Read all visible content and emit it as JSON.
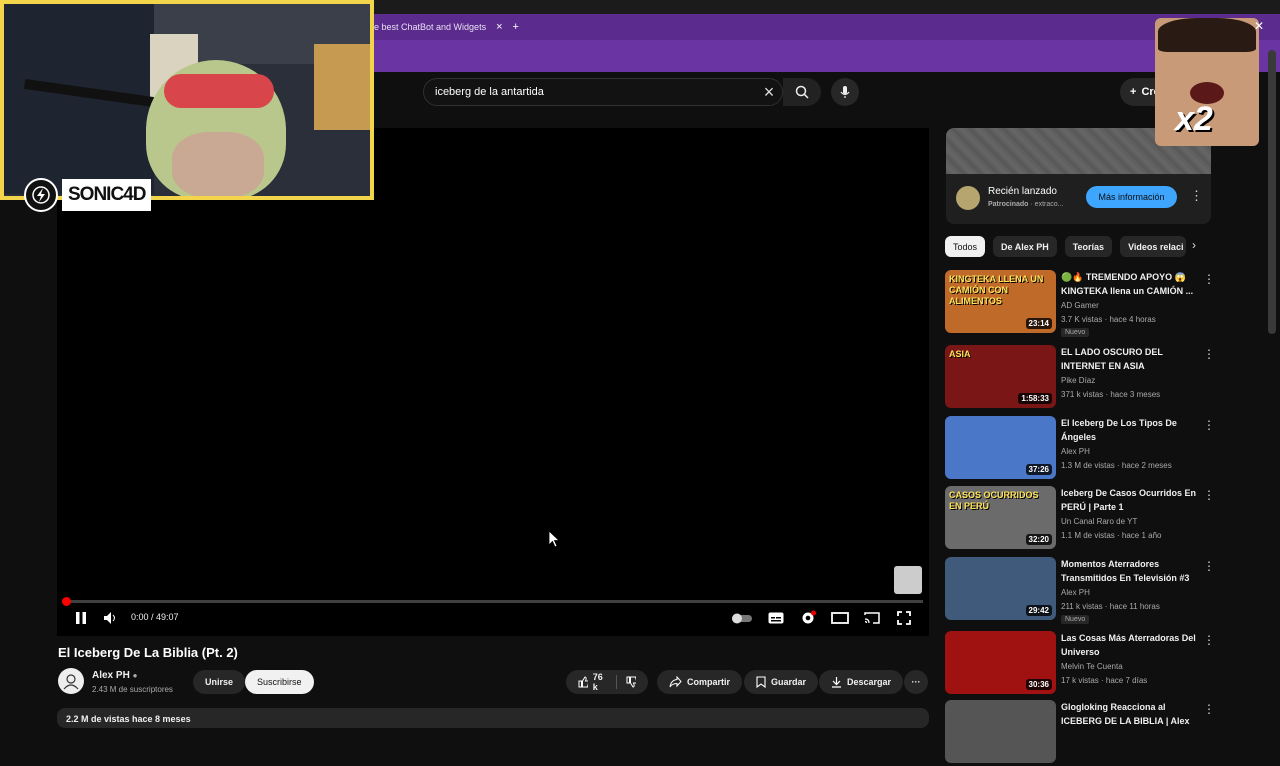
{
  "browser": {
    "tab_title": "e best ChatBot and Widgets",
    "tab_close": "×",
    "new_tab": "+"
  },
  "youtube": {
    "search_value": "iceberg de la antartida",
    "create_label": "Cre",
    "clear_icon": "×"
  },
  "stream_overlay": {
    "logo_text": "SONIC4D",
    "multiplier_text": "x2"
  },
  "player": {
    "time": "0:00 / 49:07",
    "progress": 0.0
  },
  "video": {
    "title": "El Iceberg De La Biblia (Pt. 2)",
    "channel": "Alex PH",
    "subscribers": "2.43 M de suscriptores",
    "join_label": "Unirse",
    "subscribe_label": "Suscribirse",
    "likes": "76 k",
    "share_label": "Compartir",
    "save_label": "Guardar",
    "download_label": "Descargar",
    "description_preview": "2.2 M de vistas  hace 8 meses"
  },
  "ad": {
    "title": "Recién lanzado",
    "sponsored": "Patrocinado",
    "sponsored_suffix": "· extraco...",
    "button": "Más información"
  },
  "chips": [
    "Todos",
    "De Alex PH",
    "Teorías",
    "Videos relaci"
  ],
  "recommendations": [
    {
      "title": "🟢🔥 TREMENDO APOYO 😱 KINGTEKA llena un CAMIÓN ...",
      "channel": "AD Gamer",
      "views": "3.7 K vistas · hace 4 horas",
      "badge": "Nuevo",
      "duration": "23:14",
      "thumb_text": "KINGTEKA LLENA UN CAMIÓN CON ALIMENTOS",
      "thumb_bg": "#c06a2a"
    },
    {
      "title": "EL LADO OSCURO DEL INTERNET EN ASIA",
      "channel": "Pike Díaz",
      "views": "371 k vistas · hace 3 meses",
      "badge": "",
      "duration": "1:58:33",
      "thumb_text": "ASIA",
      "thumb_bg": "#7a1616"
    },
    {
      "title": "El Iceberg De Los Tipos De Ángeles",
      "channel": "Alex PH",
      "views": "1.3 M de vistas · hace 2 meses",
      "badge": "",
      "duration": "37:26",
      "thumb_text": "",
      "thumb_bg": "#4b77c9"
    },
    {
      "title": "Iceberg De Casos Ocurridos En PERÚ | Parte 1",
      "channel": "Un Canal Raro de YT",
      "views": "1.1 M de vistas · hace 1 año",
      "badge": "",
      "duration": "32:20",
      "thumb_text": "CASOS OCURRIDOS EN PERÚ",
      "thumb_bg": "#6b6b6b"
    },
    {
      "title": "Momentos Aterradores Transmitidos En Televisión #3",
      "channel": "Alex PH",
      "views": "211 k vistas · hace 11 horas",
      "badge": "Nuevo",
      "duration": "29:42",
      "thumb_text": "",
      "thumb_bg": "#3f5a7a"
    },
    {
      "title": "Las Cosas Más Aterradoras Del Universo",
      "channel": "Melvin Te Cuenta",
      "views": "17 k vistas · hace 7 días",
      "badge": "",
      "duration": "30:36",
      "thumb_text": "",
      "thumb_bg": "#a01212"
    },
    {
      "title": "Glogloking Reacciona al ICEBERG DE LA BIBLIA | Alex",
      "channel": "",
      "views": "",
      "badge": "",
      "duration": "",
      "thumb_text": "",
      "thumb_bg": "#555555"
    }
  ],
  "colors": {
    "accent_purple": "#5b2c8e",
    "webcam_border": "#f3d54b",
    "progress_red": "#ff0000",
    "ad_button": "#3ea6ff"
  }
}
